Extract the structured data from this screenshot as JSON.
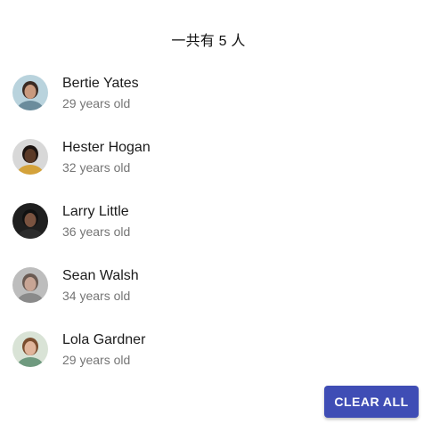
{
  "header": {
    "title": "一共有 5 人"
  },
  "people": [
    {
      "name": "Bertie Yates",
      "age": "29 years old",
      "avatar_icon": "person-avatar-icon",
      "bg": "#b9d3dd",
      "skin": "#c99a7e",
      "hair": "#3a2a22",
      "shirt": "#6b8c9c"
    },
    {
      "name": "Hester Hogan",
      "age": "32 years old",
      "avatar_icon": "person-avatar-icon",
      "bg": "#d8d8d8",
      "skin": "#5b3a27",
      "hair": "#1c1410",
      "shirt": "#d4a23a"
    },
    {
      "name": "Larry Little",
      "age": "36 years old",
      "avatar_icon": "person-avatar-icon",
      "bg": "#1f1f1f",
      "skin": "#7a5340",
      "hair": "#111111",
      "shirt": "#2c2c2c"
    },
    {
      "name": "Sean Walsh",
      "age": "34 years old",
      "avatar_icon": "person-avatar-icon",
      "bg": "#bdbdbd",
      "skin": "#c8a595",
      "hair": "#6a5a52",
      "shirt": "#8a8a8a"
    },
    {
      "name": "Lola Gardner",
      "age": "29 years old",
      "avatar_icon": "person-avatar-icon",
      "bg": "#d9e3d6",
      "skin": "#e0b59b",
      "hair": "#7a4d2e",
      "shirt": "#6f9a7f"
    }
  ],
  "actions": {
    "clear_label": "CLEAR ALL"
  },
  "colors": {
    "button": "#3f4db5",
    "secondary_text": "#757575"
  }
}
